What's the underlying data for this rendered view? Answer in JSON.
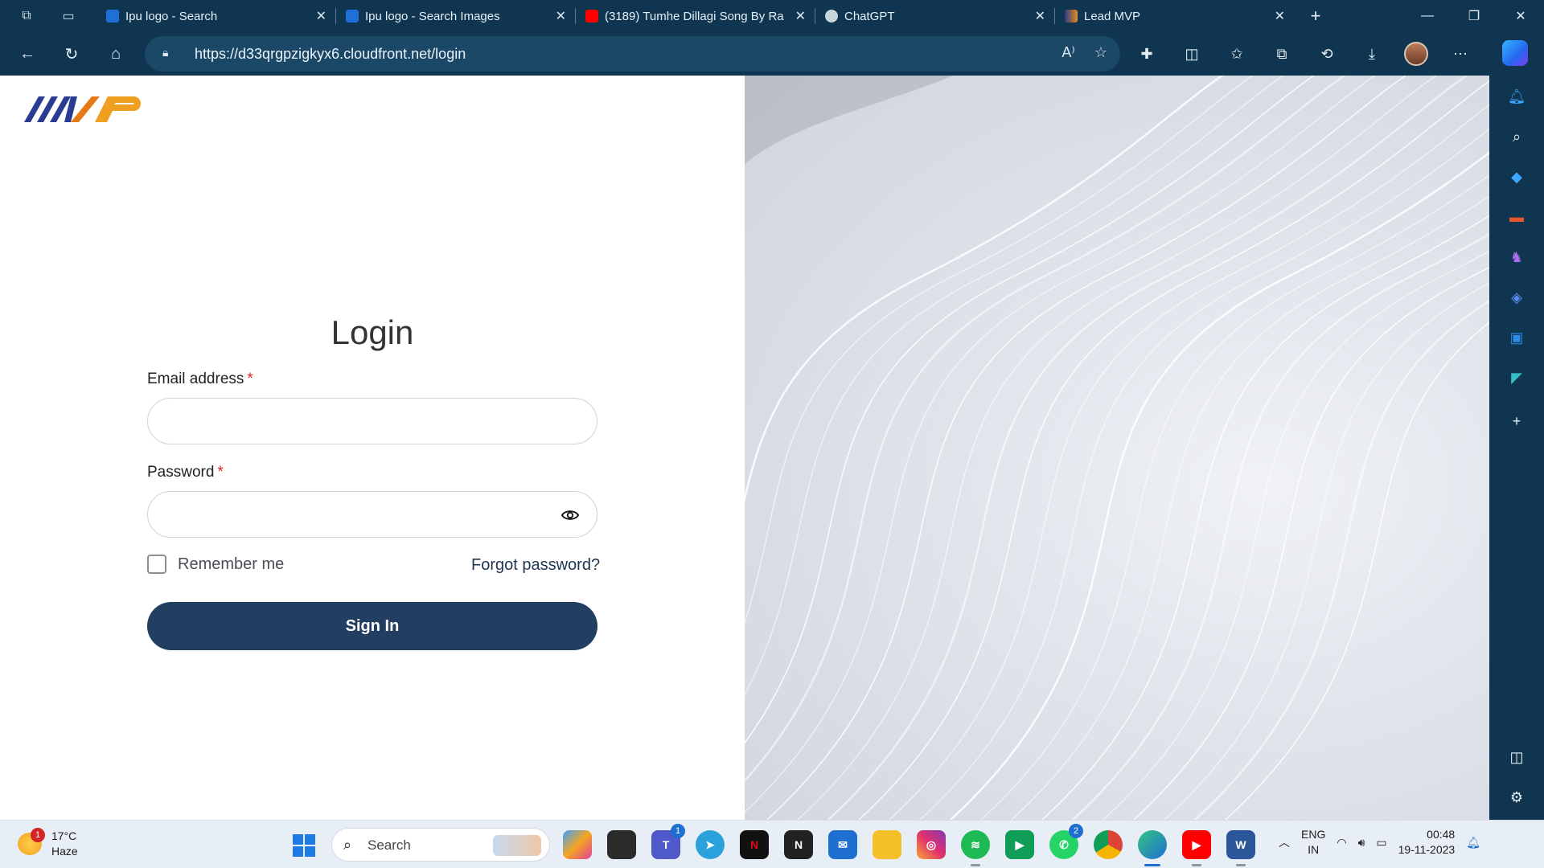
{
  "browser": {
    "tabs": [
      {
        "title": "Ipu logo - Search",
        "favicon_color": "#1f6fd6"
      },
      {
        "title": "Ipu logo - Search Images",
        "favicon_color": "#1f6fd6"
      },
      {
        "title": "(3189) Tumhe Dillagi Song By Ra",
        "favicon_color": "#ff0000"
      },
      {
        "title": "ChatGPT",
        "favicon_color": "#c9d6de"
      },
      {
        "title": "Lead MVP",
        "favicon_color": "#e58c1c"
      }
    ],
    "active_tab": 4,
    "url": "https://d33qrgpzigkyx6.cloudfront.net/login"
  },
  "login": {
    "title": "Login",
    "email_label": "Email address",
    "email_value": "",
    "password_label": "Password",
    "password_value": "",
    "required_marker": "*",
    "remember_label": "Remember me",
    "remember_checked": false,
    "forgot_label": "Forgot password?",
    "signin_label": "Sign In"
  },
  "taskbar": {
    "weather_temp": "17°C",
    "weather_desc": "Haze",
    "weather_badge": "1",
    "search_placeholder": "Search",
    "teams_badge": "1",
    "whatsapp_badge": "2",
    "lang_line1": "ENG",
    "lang_line2": "IN",
    "time": "00:48",
    "date": "19-11-2023"
  },
  "colors": {
    "browser_chrome": "#0f3550",
    "signin_button": "#223e60",
    "required_star": "#e02424",
    "link": "#1f3552"
  }
}
